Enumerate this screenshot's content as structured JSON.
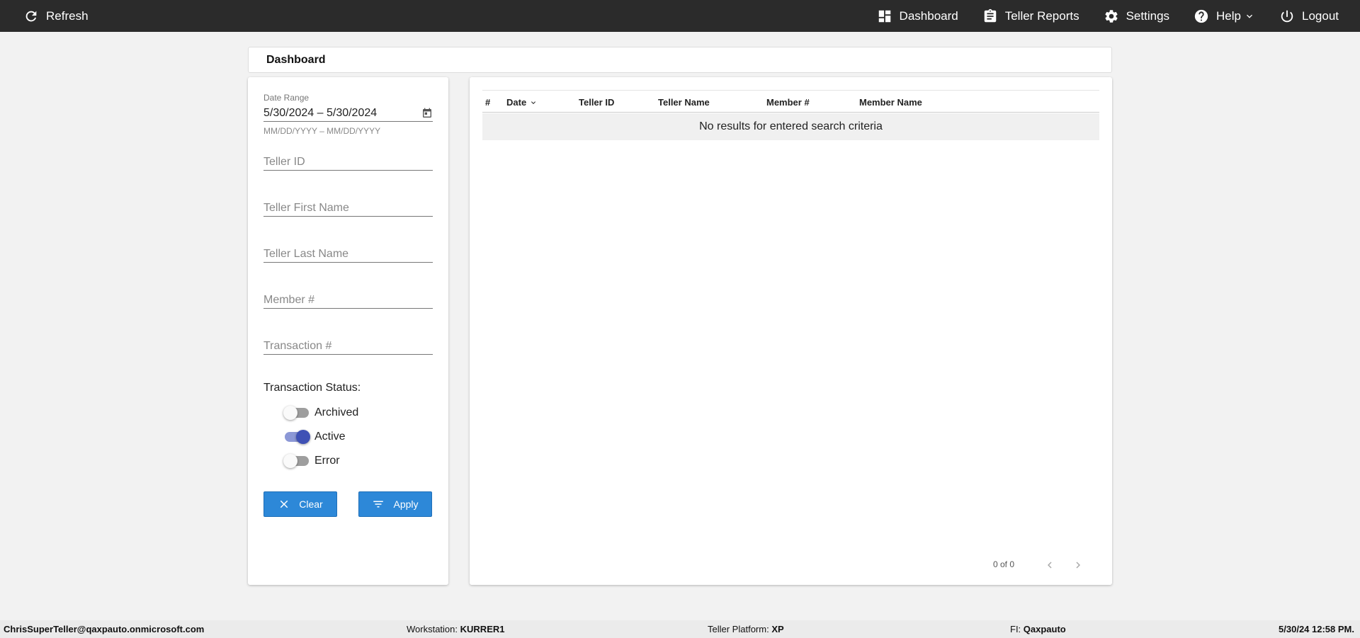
{
  "topbar": {
    "refresh_label": "Refresh",
    "nav": {
      "dashboard": "Dashboard",
      "teller_reports": "Teller Reports",
      "settings": "Settings",
      "help": "Help",
      "logout": "Logout"
    }
  },
  "page": {
    "title": "Dashboard"
  },
  "filters": {
    "date_range_label": "Date Range",
    "date_range_value": "5/30/2024 – 5/30/2024",
    "date_hint": "MM/DD/YYYY – MM/DD/YYYY",
    "teller_id_placeholder": "Teller ID",
    "teller_first_name_placeholder": "Teller First Name",
    "teller_last_name_placeholder": "Teller Last Name",
    "member_number_placeholder": "Member #",
    "transaction_number_placeholder": "Transaction #",
    "status_label": "Transaction Status:",
    "toggles": [
      {
        "label": "Archived",
        "on": false
      },
      {
        "label": "Active",
        "on": true
      },
      {
        "label": "Error",
        "on": false
      }
    ],
    "clear_label": "Clear",
    "apply_label": "Apply"
  },
  "table": {
    "columns": {
      "num": "#",
      "date": "Date",
      "teller_id": "Teller ID",
      "teller_name": "Teller Name",
      "member_num": "Member #",
      "member_name": "Member Name"
    },
    "empty_message": "No results for entered search criteria",
    "pager_text": "0 of 0"
  },
  "footer": {
    "user": "ChrisSuperTeller@qaxpauto.onmicrosoft.com",
    "workstation_label": "Workstation:",
    "workstation_value": "KURRER1",
    "platform_label": "Teller Platform:",
    "platform_value": "XP",
    "fi_label": "FI:",
    "fi_value": "Qaxpauto",
    "datetime": "5/30/24 12:58 PM."
  },
  "colors": {
    "topbar": "#2b2b2b",
    "button": "#2d88d8",
    "toggle_on": "#3f51b5"
  }
}
